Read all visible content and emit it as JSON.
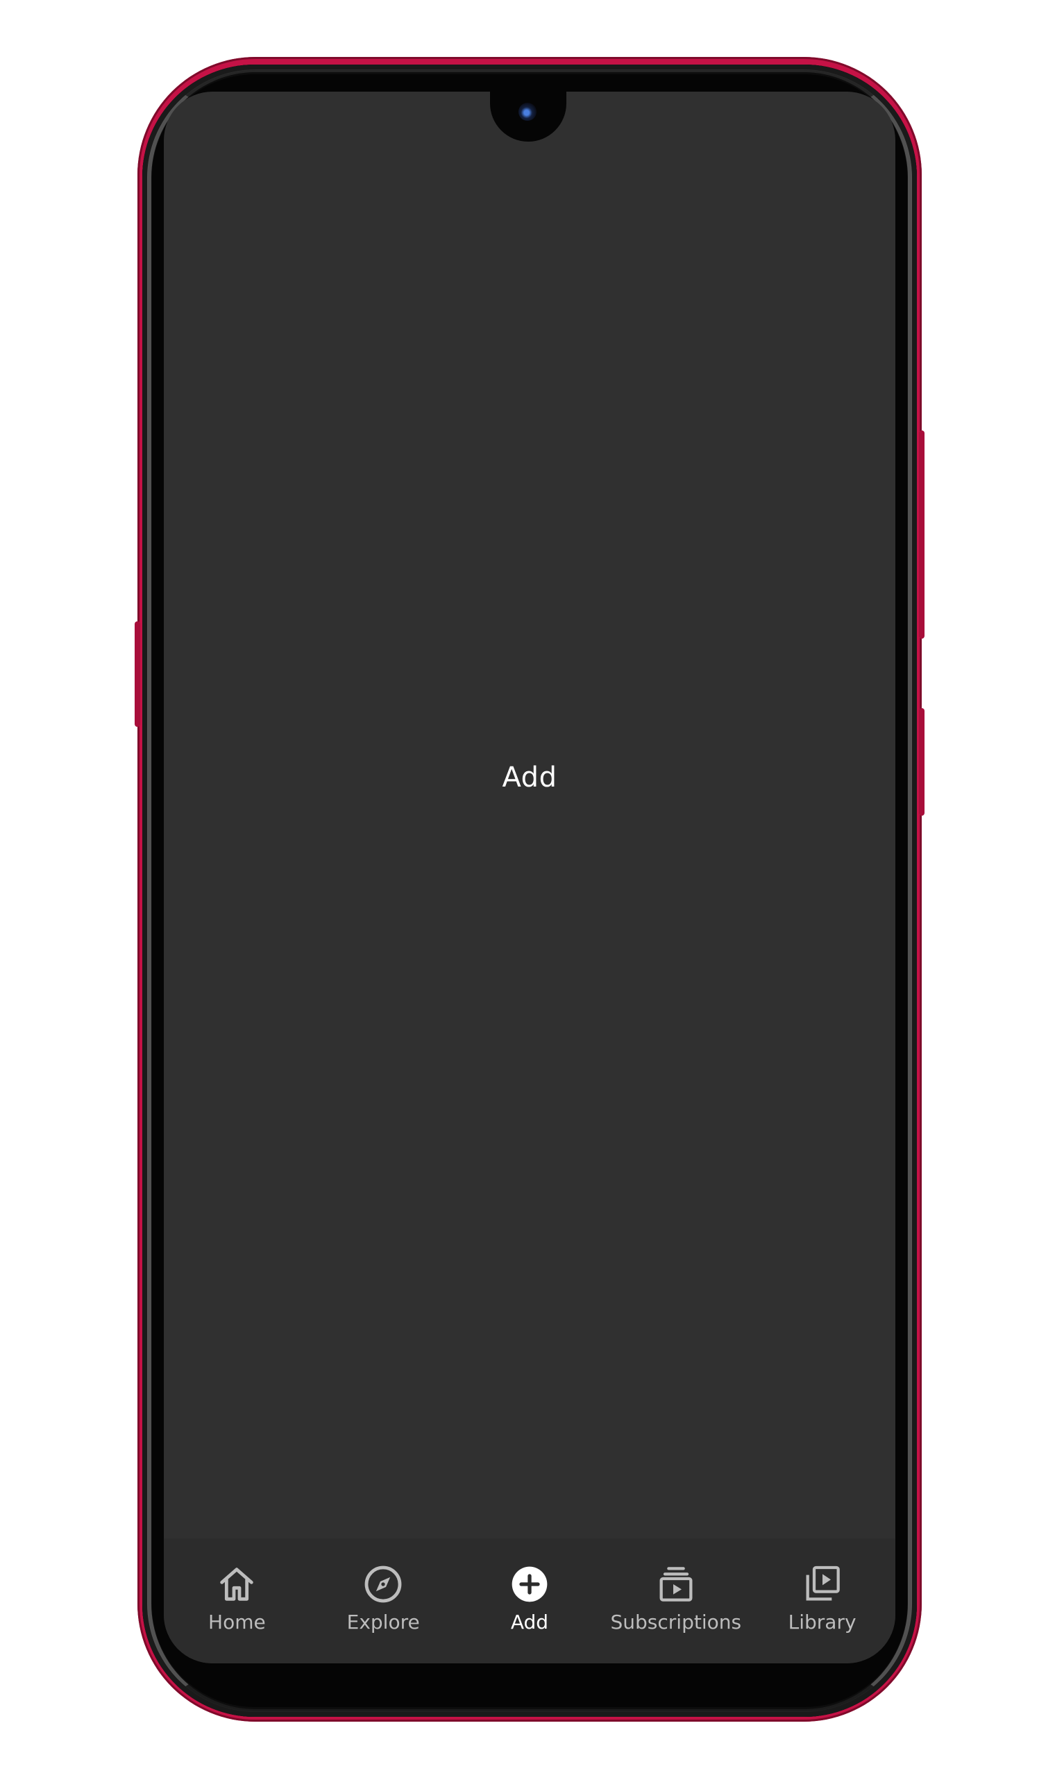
{
  "screen": {
    "page_label": "Add",
    "background_color": "#303030"
  },
  "device": {
    "frame_color": "#c51246"
  },
  "bottom_nav": {
    "active_index": 2,
    "items": [
      {
        "label": "Home",
        "icon": "home-icon"
      },
      {
        "label": "Explore",
        "icon": "compass-icon"
      },
      {
        "label": "Add",
        "icon": "add-circle-icon"
      },
      {
        "label": "Subscriptions",
        "icon": "subscriptions-icon"
      },
      {
        "label": "Library",
        "icon": "library-icon"
      }
    ]
  }
}
